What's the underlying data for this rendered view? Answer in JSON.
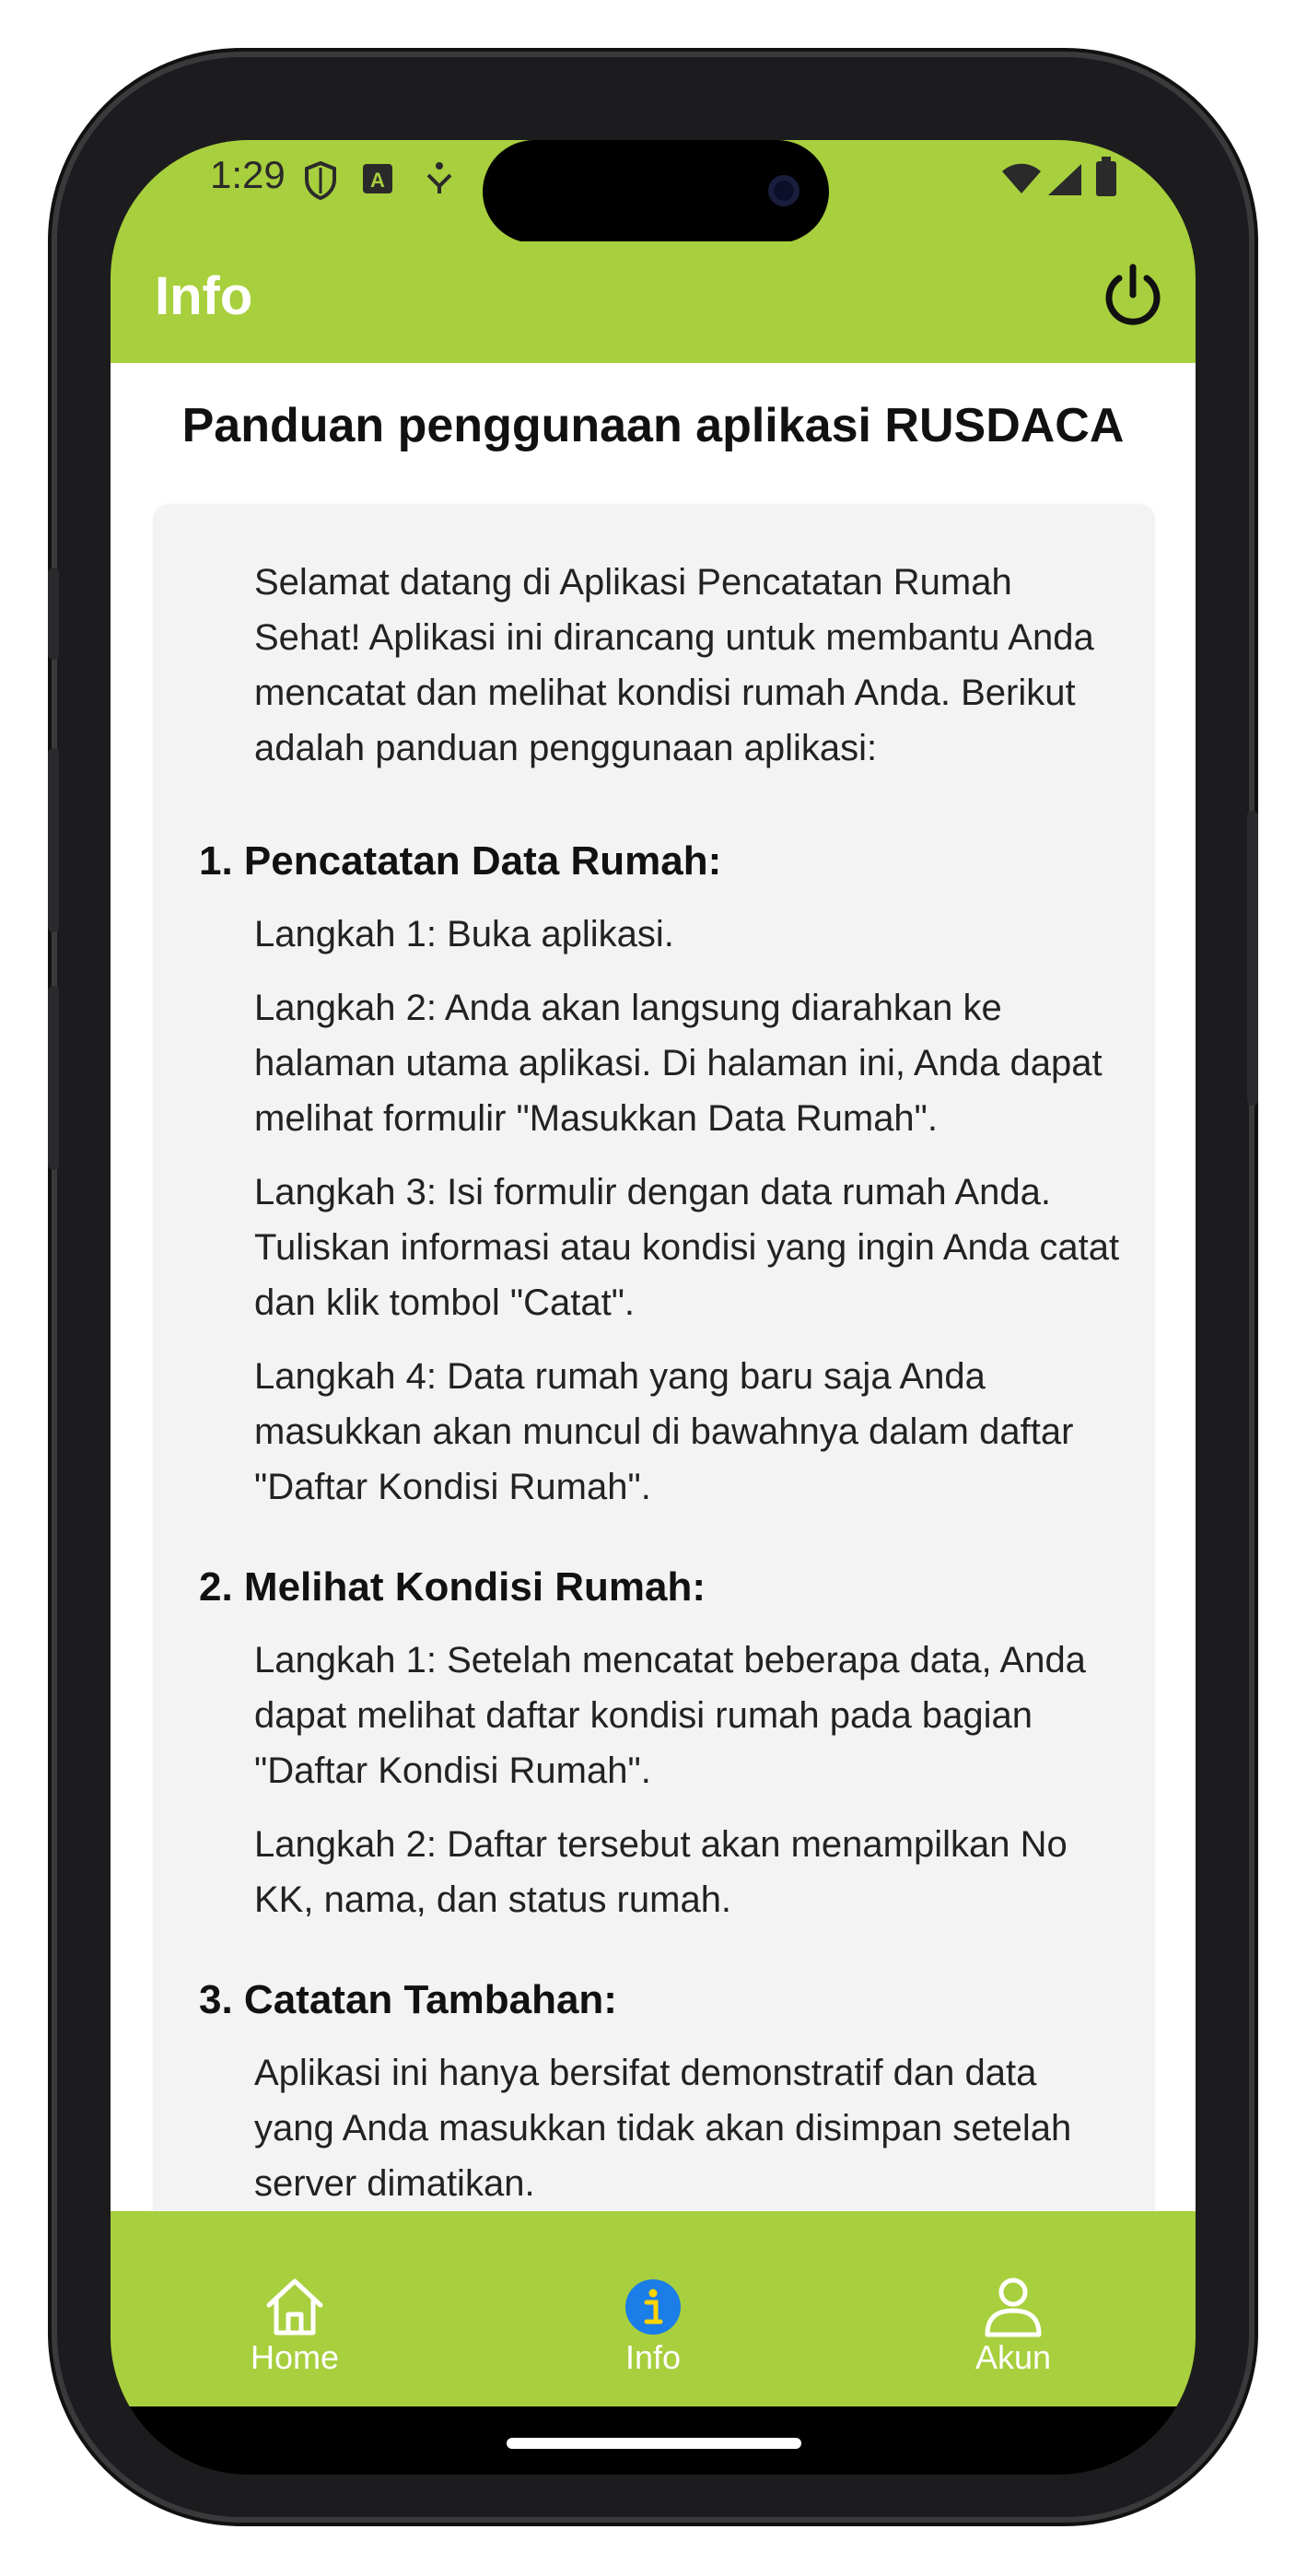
{
  "status_bar": {
    "time": "1:29",
    "icons": [
      "shield-icon",
      "a-icon",
      "download-icon",
      "wifi-icon",
      "signal-icon",
      "battery-icon"
    ]
  },
  "app_bar": {
    "title": "Info",
    "power_icon": "power-icon"
  },
  "main": {
    "title": "Panduan penggunaan aplikasi RUSDACA",
    "intro": "Selamat datang di Aplikasi Pencatatan Rumah Sehat! Aplikasi ini dirancang untuk membantu Anda mencatat dan melihat kondisi rumah Anda. Berikut adalah panduan penggunaan aplikasi:",
    "sections": [
      {
        "title": "1. Pencatatan Data Rumah:",
        "steps": [
          "Langkah 1: Buka aplikasi.",
          "Langkah 2: Anda akan langsung diarahkan ke halaman utama aplikasi. Di halaman ini, Anda dapat melihat formulir \"Masukkan Data Rumah\".",
          "Langkah 3: Isi formulir dengan data rumah Anda. Tuliskan informasi atau kondisi yang ingin Anda catat dan klik tombol \"Catat\".",
          "Langkah 4: Data rumah yang baru saja Anda masukkan akan muncul di bawahnya dalam daftar \"Daftar Kondisi Rumah\"."
        ]
      },
      {
        "title": "2. Melihat Kondisi Rumah:",
        "steps": [
          "Langkah 1: Setelah mencatat beberapa data, Anda dapat melihat daftar kondisi rumah pada bagian \"Daftar Kondisi Rumah\".",
          "Langkah 2: Daftar tersebut akan menampilkan No KK, nama, dan status rumah."
        ]
      },
      {
        "title": "3. Catatan Tambahan:",
        "steps": [
          "Aplikasi ini hanya bersifat demonstratif dan data yang Anda masukkan tidak akan disimpan setelah server dimatikan."
        ]
      }
    ]
  },
  "bottom_nav": {
    "items": [
      {
        "label": "Home",
        "icon": "home-icon"
      },
      {
        "label": "Info",
        "icon": "info-icon"
      },
      {
        "label": "Akun",
        "icon": "user-icon"
      }
    ]
  },
  "colors": {
    "accent": "#a8cf3d",
    "active_icon": "#1a7de8",
    "card_bg": "#f3f3f3"
  }
}
